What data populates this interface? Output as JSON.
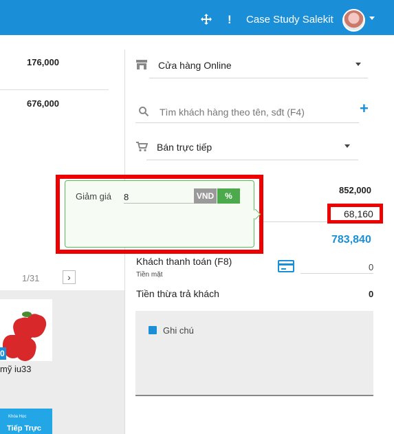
{
  "header": {
    "move_icon": "move-icon",
    "alert_icon": "exclamation-icon",
    "store_title": "Case Study Salekit"
  },
  "left": {
    "amount_1": "176,000",
    "amount_2": "676,000",
    "pager": "1/31",
    "product": {
      "price_fragment": "0",
      "name": "mỹ iu33"
    },
    "product2": {
      "small": "Khóa Học",
      "big": "Tiếp Trực"
    }
  },
  "right": {
    "channel": "Cửa hàng Online",
    "search_placeholder": "Tìm khách hàng theo tên, sđt (F4)",
    "sale_type": "Bán trực tiếp",
    "subtotal": "852,000",
    "discount": "68,160",
    "total_due": "783,840",
    "customer_pays_label": "Khách thanh toán (F8)",
    "cash_label": "Tiền mặt",
    "paid_value": "0",
    "change_label": "Tiền thừa trả khách",
    "change_value": "0",
    "notes_label": "Ghi chú"
  },
  "discount_popover": {
    "label": "Giảm giá",
    "value": "8",
    "vnd_label": "VND",
    "percent_label": "%"
  },
  "colors": {
    "header": "#1a8fd8",
    "accent": "#1a8fd8",
    "percent_active": "#4caa4c",
    "highlight": "#ee0000"
  }
}
